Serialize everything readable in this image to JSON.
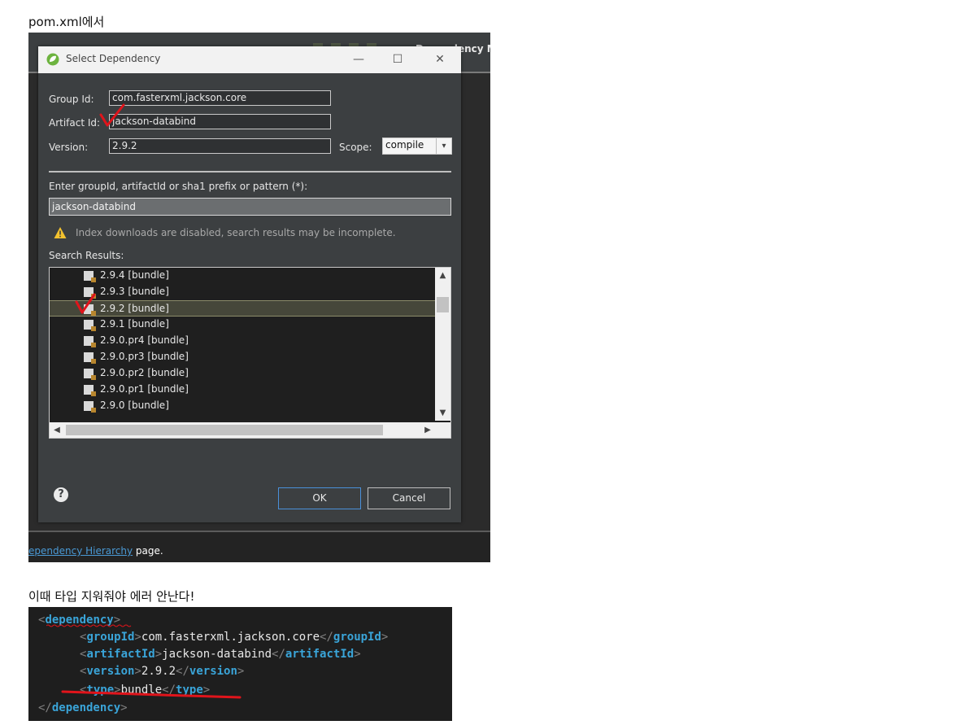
{
  "captions": {
    "top": "pom.xml에서",
    "bottom": "이때 타입 지워줘야 에러 안난다!"
  },
  "ide": {
    "tab_label": "Dependency M",
    "tab_label_visible": "ncy M",
    "bottom_link": "ependency Hierarchy",
    "bottom_suffix": " page."
  },
  "dialog": {
    "title": "Select Dependency",
    "window_buttons": {
      "minimize": "—",
      "maximize": "☐",
      "close": "✕"
    },
    "group_label": "Group Id:",
    "group_value": "com.fasterxml.jackson.core",
    "artifact_label": "Artifact Id:",
    "artifact_value": "jackson-databind",
    "version_label": "Version:",
    "version_value": "2.9.2",
    "scope_label": "Scope:",
    "scope_value": "compile",
    "pattern_label": "Enter groupId, artifactId or sha1 prefix or pattern (*):",
    "pattern_value": "jackson-databind",
    "warning": "Index downloads are disabled, search results may be incomplete.",
    "results_label": "Search Results:",
    "results": [
      "2.9.4 [bundle]",
      "2.9.3 [bundle]",
      "2.9.2 [bundle]",
      "2.9.1 [bundle]",
      "2.9.0.pr4 [bundle]",
      "2.9.0.pr3 [bundle]",
      "2.9.0.pr2 [bundle]",
      "2.9.0.pr1 [bundle]",
      "2.9.0 [bundle]"
    ],
    "selected_result": "2.9.2 [bundle]",
    "help": "?",
    "ok_label": "OK",
    "cancel_label": "Cancel"
  },
  "code": {
    "dependency_tag": "dependency",
    "group_tag": "groupId",
    "group_value": "com.fasterxml.jackson.core",
    "artifact_tag": "artifactId",
    "artifact_value": "jackson-databind",
    "version_tag": "version",
    "version_value": "2.9.2",
    "type_tag": "type",
    "type_value": "bundle"
  },
  "colors": {
    "annotation_red": "#e0141b",
    "tag_blue": "#3aa4d8",
    "selection_bg": "#46473a"
  }
}
